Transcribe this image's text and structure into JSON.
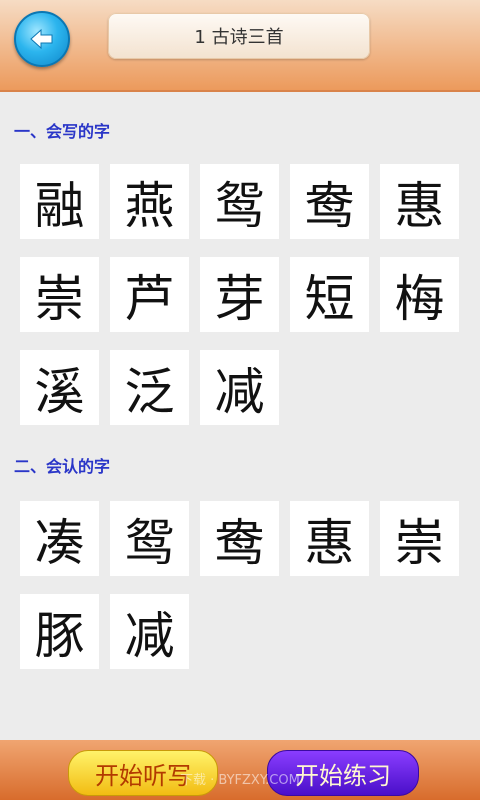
{
  "header": {
    "title": "1 古诗三首",
    "back_icon": "back-arrow-icon",
    "back_color": "#2cb5ee"
  },
  "sections": {
    "write": {
      "title": "一、会写的字",
      "chars": [
        "融",
        "燕",
        "鸳",
        "鸯",
        "惠",
        "崇",
        "芦",
        "芽",
        "短",
        "梅",
        "溪",
        "泛",
        "减"
      ]
    },
    "read": {
      "title": "二、会认的字",
      "chars": [
        "凑",
        "鸳",
        "鸯",
        "惠",
        "崇",
        "豚",
        "减"
      ]
    }
  },
  "footer": {
    "dictation_label": "开始听写",
    "practice_label": "开始练习",
    "watermark": "下载 · BYFZXY.COM"
  },
  "colors": {
    "section_title": "#2a36c8",
    "header_orange": "#ec9a5c",
    "dictation_button": "#f2bc12",
    "practice_button": "#4a0fc9"
  }
}
